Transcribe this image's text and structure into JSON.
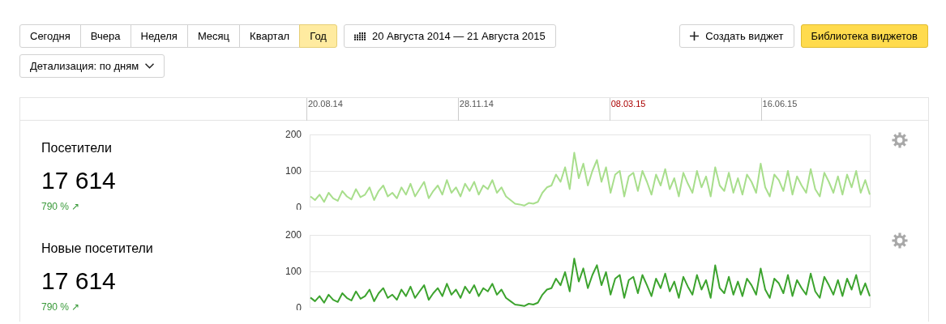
{
  "periods": [
    {
      "label": "Сегодня",
      "selected": false
    },
    {
      "label": "Вчера",
      "selected": false
    },
    {
      "label": "Неделя",
      "selected": false
    },
    {
      "label": "Месяц",
      "selected": false
    },
    {
      "label": "Квартал",
      "selected": false
    },
    {
      "label": "Год",
      "selected": true
    }
  ],
  "date_range": "20 Августа 2014 — 21 Августа 2015",
  "create_widget": "Создать виджет",
  "widget_library": "Библиотека виджетов",
  "detail_dropdown": "Детализация: по дням",
  "timeline": [
    {
      "label": "20.08.14",
      "holiday": false
    },
    {
      "label": "28.11.14",
      "holiday": false
    },
    {
      "label": "08.03.15",
      "holiday": true
    },
    {
      "label": "16.06.15",
      "holiday": false
    }
  ],
  "widgets": [
    {
      "title": "Посетители",
      "value": "17 614",
      "change": "790 % ↗",
      "chart_data": {
        "type": "line",
        "ylim": [
          0,
          200
        ],
        "yticks": [
          0,
          100,
          200
        ],
        "series": [
          {
            "color": "#a8de8c",
            "values": [
              30,
              20,
              35,
              15,
              40,
              25,
              18,
              45,
              30,
              22,
              50,
              28,
              35,
              55,
              20,
              45,
              60,
              30,
              40,
              25,
              55,
              35,
              65,
              30,
              50,
              70,
              25,
              45,
              60,
              35,
              75,
              40,
              55,
              30,
              65,
              45,
              70,
              35,
              60,
              50,
              75,
              40,
              55,
              30,
              20,
              10,
              8,
              5,
              12,
              10,
              15,
              40,
              55,
              60,
              90,
              70,
              110,
              50,
              150,
              80,
              120,
              60,
              100,
              130,
              70,
              110,
              40,
              90,
              100,
              30,
              85,
              95,
              45,
              100,
              70,
              35,
              90,
              60,
              105,
              50,
              80,
              30,
              95,
              65,
              40,
              100,
              55,
              85,
              30,
              110,
              60,
              45,
              95,
              40,
              80,
              35,
              90,
              70,
              40,
              120,
              55,
              30,
              90,
              75,
              45,
              100,
              35,
              85,
              60,
              40,
              105,
              50,
              30,
              95,
              70,
              40,
              85,
              35,
              90,
              55,
              100,
              40,
              75,
              35
            ]
          }
        ]
      }
    },
    {
      "title": "Новые посетители",
      "value": "17 614",
      "change": "790 % ↗",
      "chart_data": {
        "type": "line",
        "ylim": [
          0,
          200
        ],
        "yticks": [
          0,
          100,
          200
        ],
        "series": [
          {
            "color": "#3ca32e",
            "values": [
              28,
              18,
              32,
              14,
              36,
              22,
              16,
              40,
              27,
              20,
              45,
              25,
              32,
              50,
              18,
              40,
              54,
              27,
              36,
              22,
              50,
              32,
              58,
              27,
              45,
              62,
              22,
              40,
              54,
              32,
              66,
              36,
              50,
              27,
              58,
              40,
              62,
              32,
              54,
              45,
              66,
              36,
              50,
              27,
              18,
              9,
              7,
              5,
              11,
              9,
              14,
              36,
              50,
              54,
              80,
              62,
              98,
              45,
              135,
              72,
              108,
              54,
              90,
              117,
              62,
              98,
              36,
              80,
              90,
              27,
              76,
              85,
              40,
              90,
              62,
              32,
              80,
              54,
              94,
              45,
              72,
              27,
              85,
              58,
              36,
              90,
              50,
              76,
              27,
              117,
              54,
              40,
              85,
              36,
              72,
              32,
              80,
              62,
              36,
              108,
              50,
              27,
              80,
              67,
              40,
              90,
              32,
              76,
              54,
              36,
              94,
              45,
              27,
              85,
              62,
              36,
              76,
              32,
              80,
              50,
              90,
              36,
              67,
              32
            ]
          }
        ]
      }
    }
  ]
}
